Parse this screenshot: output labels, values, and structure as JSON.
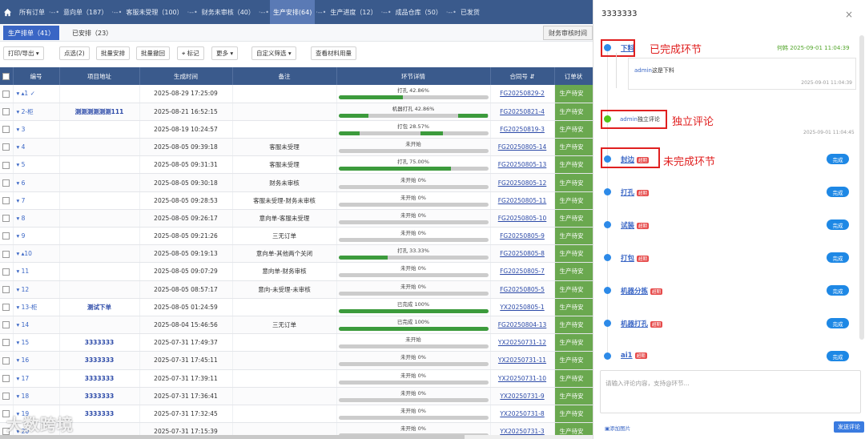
{
  "nav": {
    "crumbs": [
      "所有订单",
      "意向单（187）",
      "客服未受理（100）",
      "财务未审核（40）",
      "生产安排(64)",
      "生产进度（12）",
      "成品仓库（50）",
      "已发货"
    ]
  },
  "tabs": {
    "scheduled": "生产排单（41）",
    "arranged": "已安排（23）",
    "finance_btn": "财务审核时间"
  },
  "toolbar": [
    "打印/导出",
    "点选(2)",
    "批量安排",
    "批量撤回",
    "标记",
    "更多",
    "自定义筛选",
    "查看材料用量"
  ],
  "table": {
    "headers": [
      "编号",
      "项目地址",
      "生成时间",
      "备注",
      "环节详情",
      "合同号",
      "订单状"
    ],
    "rows": [
      {
        "no": "▾ ▴1 ✓",
        "addr": "",
        "time": "2025-08-29 17:25:09",
        "note": "",
        "prog": "打孔 42.86%",
        "ct": "FG20250829-2",
        "st": "生产待安"
      },
      {
        "no": "▾ 2-柜",
        "addr": "测测测测测测111",
        "time": "2025-08-21 16:52:15",
        "note": "",
        "prog": "机器打孔 42.86%",
        "ct": "FG20250821-4",
        "st": "生产待安"
      },
      {
        "no": "▾ 3",
        "addr": "",
        "time": "2025-08-19 10:24:57",
        "note": "",
        "prog": "打包 28.57%",
        "ct": "FG20250819-3",
        "st": "生产待安"
      },
      {
        "no": "▾ 4",
        "addr": "",
        "time": "2025-08-05 09:39:18",
        "note": "客服未受理",
        "prog": "未开始",
        "ct": "FG20250805-14",
        "st": "生产待安"
      },
      {
        "no": "▾ 5",
        "addr": "",
        "time": "2025-08-05 09:31:31",
        "note": "客服未受理",
        "prog": "打孔 75.00%",
        "ct": "FG20250805-13",
        "st": "生产待安"
      },
      {
        "no": "▾ 6",
        "addr": "",
        "time": "2025-08-05 09:30:18",
        "note": "财务未审核",
        "prog": "未开始 0%",
        "ct": "FG20250805-12",
        "st": "生产待安"
      },
      {
        "no": "▾ 7",
        "addr": "",
        "time": "2025-08-05 09:28:53",
        "note": "客服未受理-财务未审核",
        "prog": "未开始 0%",
        "ct": "FG20250805-11",
        "st": "生产待安"
      },
      {
        "no": "▾ 8",
        "addr": "",
        "time": "2025-08-05 09:26:17",
        "note": "意向单-客服未受理",
        "prog": "未开始 0%",
        "ct": "FG20250805-10",
        "st": "生产待安"
      },
      {
        "no": "▾ 9",
        "addr": "",
        "time": "2025-08-05 09:21:26",
        "note": "三无订单",
        "prog": "未开始 0%",
        "ct": "FG20250805-9",
        "st": "生产待安"
      },
      {
        "no": "▾ ▴10",
        "addr": "",
        "time": "2025-08-05 09:19:13",
        "note": "意向单-其他两个关闭",
        "prog": "打孔 33.33%",
        "ct": "FG20250805-8",
        "st": "生产待安"
      },
      {
        "no": "▾ 11",
        "addr": "",
        "time": "2025-08-05 09:07:29",
        "note": "意向单-财务审核",
        "prog": "未开始 0%",
        "ct": "FG20250805-7",
        "st": "生产待安"
      },
      {
        "no": "▾ 12",
        "addr": "",
        "time": "2025-08-05 08:57:17",
        "note": "意向-未受理-未审核",
        "prog": "未开始 0%",
        "ct": "FG20250805-5",
        "st": "生产待安"
      },
      {
        "no": "▾ 13-柜",
        "addr": "测试下单",
        "time": "2025-08-05 01:24:59",
        "note": "",
        "prog": "已完成 100%",
        "ct": "YX20250805-1",
        "st": "生产待安"
      },
      {
        "no": "▾ 14",
        "addr": "",
        "time": "2025-08-04 15:46:56",
        "note": "三无订单",
        "prog": "已完成 100%",
        "ct": "FG20250804-13",
        "st": "生产待安"
      },
      {
        "no": "▾ 15",
        "addr": "3333333",
        "time": "2025-07-31 17:49:37",
        "note": "",
        "prog": "未开始",
        "ct": "YX20250731-12",
        "st": "生产待安"
      },
      {
        "no": "▾ 16",
        "addr": "3333333",
        "time": "2025-07-31 17:45:11",
        "note": "",
        "prog": "未开始 0%",
        "ct": "YX20250731-11",
        "st": "生产待安"
      },
      {
        "no": "▾ 17",
        "addr": "3333333",
        "time": "2025-07-31 17:39:11",
        "note": "",
        "prog": "未开始 0%",
        "ct": "YX20250731-10",
        "st": "生产待安"
      },
      {
        "no": "▾ 18",
        "addr": "3333333",
        "time": "2025-07-31 17:36:41",
        "note": "",
        "prog": "未开始 0%",
        "ct": "YX20250731-9",
        "st": "生产待安"
      },
      {
        "no": "▾ 19",
        "addr": "3333333",
        "time": "2025-07-31 17:32:45",
        "note": "",
        "prog": "未开始 0%",
        "ct": "YX20250731-8",
        "st": "生产待安"
      },
      {
        "no": "▾ 20",
        "addr": "",
        "time": "2025-07-31 17:15:39",
        "note": "",
        "prog": "未开始 0%",
        "ct": "YX20250731-3",
        "st": "生产待安"
      }
    ],
    "bars": [
      [
        [
          0,
          0.43
        ]
      ],
      [
        [
          0,
          0.2
        ],
        [
          0.8,
          1
        ]
      ],
      [
        [
          0,
          0.14
        ],
        [
          0.55,
          0.7
        ]
      ],
      [],
      [
        [
          0,
          0.75
        ]
      ],
      [],
      [],
      [],
      [],
      [
        [
          0,
          0.33
        ]
      ],
      [],
      [],
      [
        [
          0,
          1
        ]
      ],
      [
        [
          0,
          1
        ]
      ],
      [],
      [],
      [],
      [],
      [],
      []
    ]
  },
  "panel": {
    "title": "3333333",
    "close": "×",
    "node1": {
      "name": "下料",
      "done_time": "何韩 2025-09-01 11:04:39",
      "annotation": "已完成环节"
    },
    "sub": {
      "user": "admin",
      "text": "这是下料",
      "time": "2025-09-01 11:04:39"
    },
    "comment": {
      "user": "admin",
      "text": "独立评论",
      "time": "2025-09-01 11:04:45",
      "annotation": "独立评论"
    },
    "annotation_incomplete": "未完成环节",
    "tag": "超期",
    "done_label": "完成",
    "nodes": [
      "封边",
      "打孔",
      "试装",
      "打包",
      "机器分拣",
      "机器打孔",
      "ai1"
    ],
    "placeholder": "请输入评论内容，支持@环节...",
    "add_image": "添加图片",
    "send": "发送评论"
  },
  "watermark": "大数跨境",
  "colors": {
    "header": "#3a5a8c",
    "accent": "#3a66c5",
    "done": "#1e88e5",
    "red": "#e02020",
    "green": "#52c41a"
  }
}
